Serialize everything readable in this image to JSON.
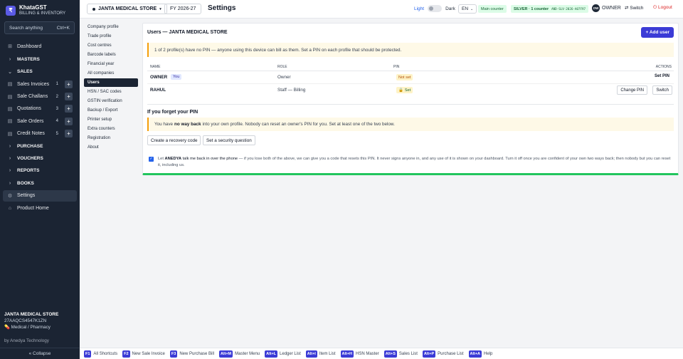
{
  "brand": {
    "logo": "₹",
    "name": "KhataGST",
    "subtitle": "BILLING & INVENTORY"
  },
  "search": {
    "placeholder": "Search anything",
    "shortcut": "Ctrl+K"
  },
  "sidebar": {
    "items": [
      {
        "label": "Dashboard",
        "icon": "grid-icon",
        "glyph": "⊞",
        "kind": "link"
      },
      {
        "label": "MASTERS",
        "icon": "chevron-right-icon",
        "glyph": "›",
        "kind": "section"
      },
      {
        "label": "SALES",
        "icon": "chevron-down-icon",
        "glyph": "⌄",
        "kind": "section"
      },
      {
        "label": "Sales Invoices",
        "icon": "invoice-icon",
        "glyph": "▤",
        "count": "1",
        "kind": "sub"
      },
      {
        "label": "Sale Challans",
        "icon": "challan-icon",
        "glyph": "▤",
        "count": "2",
        "kind": "sub"
      },
      {
        "label": "Quotations",
        "icon": "quotation-icon",
        "glyph": "▤",
        "count": "3",
        "kind": "sub"
      },
      {
        "label": "Sale Orders",
        "icon": "order-icon",
        "glyph": "▤",
        "count": "4",
        "kind": "sub"
      },
      {
        "label": "Credit Notes",
        "icon": "credit-note-icon",
        "glyph": "▤",
        "count": "5",
        "kind": "sub"
      },
      {
        "label": "PURCHASE",
        "icon": "chevron-right-icon",
        "glyph": "›",
        "kind": "section"
      },
      {
        "label": "VOUCHERS",
        "icon": "chevron-right-icon",
        "glyph": "›",
        "kind": "section"
      },
      {
        "label": "REPORTS",
        "icon": "chevron-right-icon",
        "glyph": "›",
        "kind": "section"
      },
      {
        "label": "BOOKS",
        "icon": "chevron-right-icon",
        "glyph": "›",
        "kind": "section"
      },
      {
        "label": "Settings",
        "icon": "gear-icon",
        "glyph": "⚙",
        "kind": "active"
      },
      {
        "label": "Product Home",
        "icon": "home-icon",
        "glyph": "⌂",
        "kind": "link"
      }
    ],
    "plus_label": "+",
    "footer": {
      "store": "JANTA MEDICAL STORE",
      "gstin": "27AAQCS4547K1ZN",
      "category": "Medical / Pharmacy",
      "by": "by Anedya Technology"
    },
    "collapse_label": "« Collapse"
  },
  "topbar": {
    "store": "JANTA MEDICAL STORE",
    "fy": "FY 2026-27",
    "title": "Settings",
    "theme_light": "Light",
    "theme_dark": "Dark",
    "lang": "EN",
    "main_counter": "Main counter",
    "license_label": "SILVER · 1 counter",
    "license_key": "AND-SLV-2026-A07F97",
    "owner_initials": "OW",
    "owner": "OWNER",
    "switch": "⇄ Switch",
    "logout": "Logout"
  },
  "settings_nav": [
    "Company profile",
    "Trade profile",
    "Cost centres",
    "Barcode labels",
    "Financial year",
    "All companies",
    "Users",
    "HSN / SAC codes",
    "GSTIN verification",
    "Backup / Export",
    "Printer setup",
    "Extra counters",
    "Registration",
    "About"
  ],
  "settings_active": "Users",
  "users": {
    "title": "Users — JANTA MEDICAL STORE",
    "add_button": "+ Add user",
    "warning": "1 of 2 profile(s) have no PIN — anyone using this device can bill as them. Set a PIN on each profile that should be protected.",
    "columns": {
      "name": "NAME",
      "role": "ROLE",
      "pin": "PIN",
      "actions": "ACTIONS"
    },
    "rows": [
      {
        "name": "OWNER",
        "you": "You",
        "role": "Owner",
        "pin": "Not set",
        "action1": "Set PIN"
      },
      {
        "name": "RAHUL",
        "role": "Staff — Billing",
        "pin": "Set",
        "action1": "Change PIN",
        "action2": "Switch"
      }
    ]
  },
  "forgot": {
    "title": "If you forget your PIN",
    "warn_pre": "You have",
    "warn_bold": "no way back",
    "warn_post": "into your own profile. Nobody can reset an owner's PIN for you. Set at least one of the two below.",
    "recovery_button": "Create a recovery code",
    "question_button": "Set a security question",
    "consent_pre": "Let",
    "consent_bold": "ANEDYA",
    "consent_mid": "talk me back in over the phone",
    "consent_post": "— if you lose both of the above, we can give you a code that resets this PIN. It never signs anyone in, and any use of it is shown on your dashboard. Turn it off once you are confident of your own two ways back; then nobody but you can reset it, including us."
  },
  "shortcuts": [
    {
      "key": "F1",
      "label": "All Shortcuts"
    },
    {
      "key": "F2",
      "label": "New Sale Invoice"
    },
    {
      "key": "F3",
      "label": "New Purchase Bill"
    },
    {
      "key": "Alt+M",
      "label": "Master Menu"
    },
    {
      "key": "Alt+L",
      "label": "Ledger List"
    },
    {
      "key": "Alt+I",
      "label": "Item List"
    },
    {
      "key": "Alt+H",
      "label": "HSN Master"
    },
    {
      "key": "Alt+S",
      "label": "Sales List"
    },
    {
      "key": "Alt+P",
      "label": "Purchase List"
    },
    {
      "key": "Alt+A",
      "label": "Help"
    }
  ],
  "colors": {
    "sidebar": "#1b2433",
    "accent": "#3b3bd6",
    "success": "#22c55e",
    "warning_bg": "#fef9e7",
    "danger": "#dc2626"
  }
}
